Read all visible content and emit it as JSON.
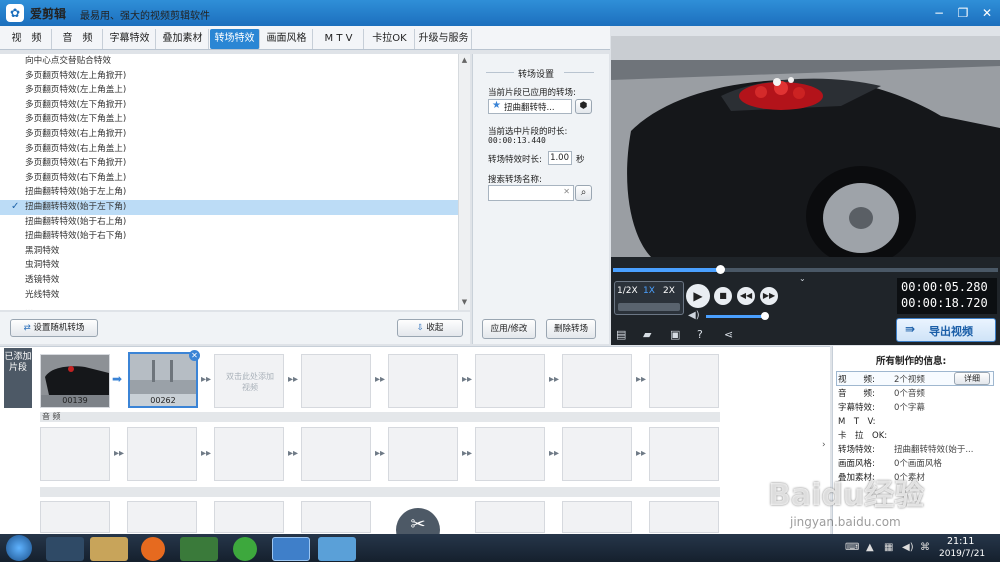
{
  "app": {
    "logo": "✿",
    "name": "爱剪辑",
    "slogan": "最易用、强大的视频剪辑软件",
    "win_min": "−",
    "win_max": "❐",
    "win_close": "✕"
  },
  "tabs": [
    {
      "label": "视　频"
    },
    {
      "label": "音　频"
    },
    {
      "label": "字幕特效"
    },
    {
      "label": "叠加素材"
    },
    {
      "label": "转场特效"
    },
    {
      "label": "画面风格"
    },
    {
      "label": "M T V"
    },
    {
      "label": "卡拉OK"
    },
    {
      "label": "升级与服务"
    }
  ],
  "transitions": [
    "向中心点交替贴合特效",
    "多页翻页特效(左上角掀开)",
    "多页翻页特效(左上角盖上)",
    "多页翻页特效(左下角掀开)",
    "多页翻页特效(左下角盖上)",
    "多页翻页特效(右上角掀开)",
    "多页翻页特效(右上角盖上)",
    "多页翻页特效(右下角掀开)",
    "多页翻页特效(右下角盖上)",
    "扭曲翻转特效(始于左上角)",
    "扭曲翻转特效(始于左下角)",
    "扭曲翻转特效(始于右上角)",
    "扭曲翻转特效(始于右下角)",
    "黑洞特效",
    "虫洞特效",
    "透镜特效",
    "光线特效",
    "..."
  ],
  "selected_check": "✓",
  "list_buttons": {
    "random": "设置随机转场",
    "collapse": "收起"
  },
  "settings": {
    "title": "转场设置",
    "applied_label": "当前片段已应用的转场:",
    "applied_value": "扭曲翻转特...",
    "current_duration_label": "当前选中片段的时长:",
    "current_duration_value": "00:00:13.440",
    "effect_duration_label": "转场特效时长:",
    "effect_duration_value": "1.00",
    "seconds": "秒",
    "search_label": "搜索转场名称:",
    "search_value": "",
    "search_clear": "✕",
    "apply_button": "应用/修改",
    "delete_button": "删除转场"
  },
  "player": {
    "speed_options": [
      "1/2X",
      "1X",
      "2X"
    ],
    "current_time": "00:00:05.280",
    "total_time": "00:00:18.720",
    "export_label": "导出视频",
    "progress": 0.275
  },
  "timeline": {
    "side_label": "已添加片段",
    "clips": [
      {
        "label": "00139"
      },
      {
        "label": "00262"
      }
    ],
    "add_hint": "双击此处添加视频",
    "audio_label": "音 频"
  },
  "info": {
    "title": "所有制作的信息:",
    "detail_button": "详细",
    "rows": [
      {
        "k": "视　　频:",
        "v": "2个视频"
      },
      {
        "k": "音　　频:",
        "v": "0个音频"
      },
      {
        "k": "字幕特效:",
        "v": "0个字幕"
      },
      {
        "k": "M　T　V:",
        "v": ""
      },
      {
        "k": "卡　拉　OK:",
        "v": ""
      },
      {
        "k": "转场特效:",
        "v": "扭曲翻转特效(始于..."
      },
      {
        "k": "画面风格:",
        "v": "0个画面风格"
      },
      {
        "k": "叠加素材:",
        "v": "0个素材"
      }
    ]
  },
  "taskbar": {
    "clock_time": "21:11",
    "clock_date": "2019/7/21"
  },
  "watermark": {
    "text": "Baidu经验",
    "url": "jingyan.baidu.com"
  }
}
